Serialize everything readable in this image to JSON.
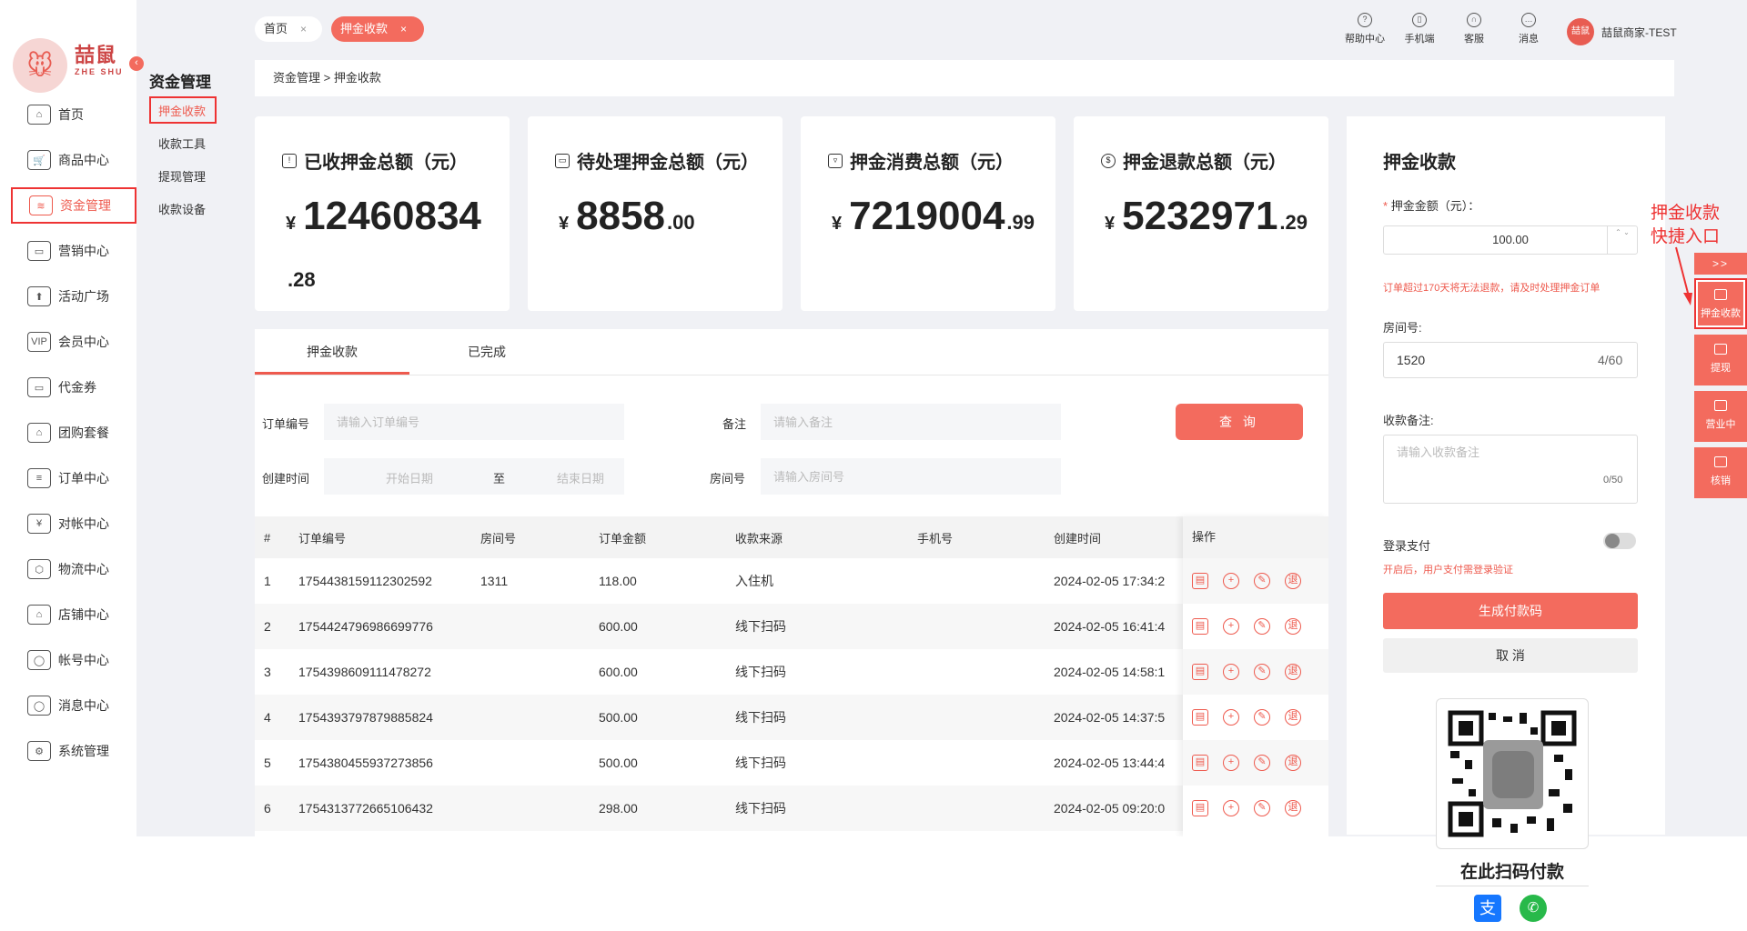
{
  "brand": {
    "logo_text": "喆鼠",
    "logo_sub": "ZHE SHU",
    "collapse_icon": "‹"
  },
  "nav": {
    "items": [
      {
        "label": "首页",
        "icon": "home-icon",
        "glyph": "⌂"
      },
      {
        "label": "商品中心",
        "icon": "cart-icon",
        "glyph": "🛒"
      },
      {
        "label": "资金管理",
        "icon": "layers-icon",
        "glyph": "≋"
      },
      {
        "label": "营销中心",
        "icon": "video-icon",
        "glyph": "▭"
      },
      {
        "label": "活动广场",
        "icon": "gift-icon",
        "glyph": "⬆"
      },
      {
        "label": "会员中心",
        "icon": "vip-card-icon",
        "glyph": "VIP"
      },
      {
        "label": "代金券",
        "icon": "coupon-icon",
        "glyph": "▭"
      },
      {
        "label": "团购套餐",
        "icon": "package-icon",
        "glyph": "⌂"
      },
      {
        "label": "订单中心",
        "icon": "order-icon",
        "glyph": "≡"
      },
      {
        "label": "对帐中心",
        "icon": "yen-icon",
        "glyph": "¥"
      },
      {
        "label": "物流中心",
        "icon": "box-icon",
        "glyph": "⬡"
      },
      {
        "label": "店铺中心",
        "icon": "store-icon",
        "glyph": "⌂"
      },
      {
        "label": "帐号中心",
        "icon": "user-icon",
        "glyph": "◯"
      },
      {
        "label": "消息中心",
        "icon": "message-icon",
        "glyph": "◯"
      },
      {
        "label": "系统管理",
        "icon": "settings-icon",
        "glyph": "⚙"
      }
    ]
  },
  "subnav": {
    "title": "资金管理",
    "items": [
      "押金收款",
      "收款工具",
      "提现管理",
      "收款设备"
    ]
  },
  "topbar": {
    "tabs": [
      {
        "label": "首页",
        "close": "×"
      },
      {
        "label": "押金收款",
        "close": "×"
      }
    ],
    "tools": [
      {
        "label": "帮助中心",
        "glyph": "?"
      },
      {
        "label": "手机端",
        "glyph": "▯"
      },
      {
        "label": "客服",
        "glyph": "∩"
      },
      {
        "label": "消息",
        "glyph": "…"
      }
    ],
    "avatar_text": "喆鼠",
    "user": "喆鼠商家-TEST"
  },
  "breadcrumb": "资金管理 > 押金收款",
  "stats": [
    {
      "title": "已收押金总额（元）",
      "currency": "¥",
      "integer": "12460834",
      "decimal": ".28",
      "icon": "receipt-icon"
    },
    {
      "title": "待处理押金总额（元）",
      "currency": "¥",
      "integer": "8858",
      "decimal": ".00",
      "icon": "wallet-icon"
    },
    {
      "title": "押金消费总额（元）",
      "currency": "¥",
      "integer": "7219004",
      "decimal": ".99",
      "icon": "trash-icon"
    },
    {
      "title": "押金退款总额（元）",
      "currency": "¥",
      "integer": "5232971",
      "decimal": ".29",
      "icon": "refund-icon"
    }
  ],
  "list_tabs": [
    "押金收款",
    "已完成"
  ],
  "filters": {
    "order_label": "订单编号",
    "order_placeholder": "请输入订单编号",
    "remark_label": "备注",
    "remark_placeholder": "请输入备注",
    "query_button": "查 询",
    "created_label": "创建时间",
    "start_placeholder": "开始日期",
    "to": "至",
    "end_placeholder": "结束日期",
    "room_label": "房间号",
    "room_placeholder": "请输入房间号"
  },
  "table": {
    "headers": [
      "#",
      "订单编号",
      "房间号",
      "订单金额",
      "收款来源",
      "手机号",
      "创建时间",
      "操作"
    ],
    "rows": [
      [
        "1",
        "1754438159112302592",
        "1311",
        "118.00",
        "入住机",
        "",
        "2024-02-05 17:34:2"
      ],
      [
        "2",
        "1754424796986699776",
        "",
        "600.00",
        "线下扫码",
        "",
        "2024-02-05 16:41:4"
      ],
      [
        "3",
        "1754398609111478272",
        "",
        "600.00",
        "线下扫码",
        "",
        "2024-02-05 14:58:1"
      ],
      [
        "4",
        "1754393797879885824",
        "",
        "500.00",
        "线下扫码",
        "",
        "2024-02-05 14:37:5"
      ],
      [
        "5",
        "1754380455937273856",
        "",
        "500.00",
        "线下扫码",
        "",
        "2024-02-05 13:44:4"
      ],
      [
        "6",
        "1754313772665106432",
        "",
        "298.00",
        "线下扫码",
        "",
        "2024-02-05 09:20:0"
      ]
    ],
    "action_icons": [
      "document-icon",
      "add-icon",
      "edit-icon",
      "refund-icon"
    ],
    "action_glyphs": [
      "▤",
      "+",
      "✎",
      "退"
    ]
  },
  "form": {
    "title": "押金收款",
    "required_mark": "*",
    "amount_label": "押金金额（元）：",
    "amount_value": "100.00",
    "spinner": "⌃ ⌄",
    "warning": "订单超过170天将无法退款，请及时处理押金订单",
    "room_label": "房间号:",
    "room_value": "1520",
    "room_count": "4/60",
    "remark_label": "收款备注:",
    "remark_placeholder": "请输入收款备注",
    "remark_count": "0/50",
    "login_pay_label": "登录支付",
    "login_pay_hint": "开启后，用户支付需登录验证",
    "generate_button": "生成付款码",
    "cancel_button": "取 消",
    "qr_caption": "在此扫码付款",
    "alipay_glyph": "支",
    "wechat_glyph": "✆"
  },
  "quickbar": {
    "annotation_line1": "押金收款",
    "annotation_line2": "快捷入口",
    "expand": ">>",
    "items": [
      "押金收款",
      "提现",
      "营业中",
      "核销"
    ]
  },
  "colors": {
    "accent": "#f36b5e",
    "highlight": "#e33333",
    "bg": "#f0f1f5"
  }
}
